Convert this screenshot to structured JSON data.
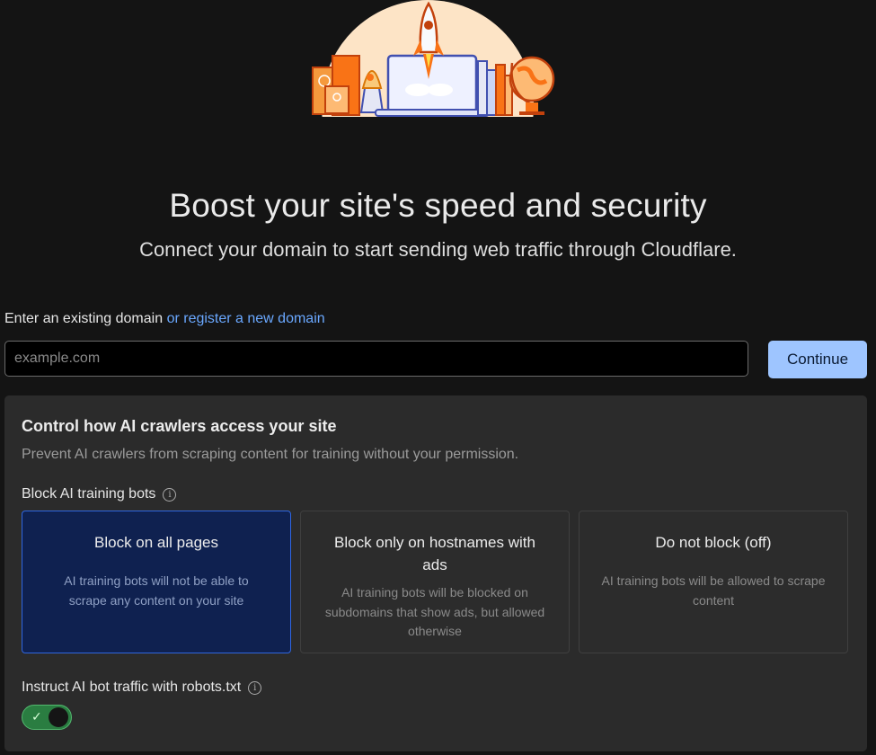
{
  "hero": {
    "icon": "rocket-launch-illustration"
  },
  "heading": "Boost your site's speed and security",
  "subtitle": "Connect your domain to start sending web traffic through Cloudflare.",
  "domain": {
    "label": "Enter an existing domain",
    "register_link": "or register a new domain",
    "placeholder": "example.com",
    "value": "",
    "continue_label": "Continue"
  },
  "ai_panel": {
    "title": "Control how AI crawlers access your site",
    "description": "Prevent AI crawlers from scraping content for training without your permission.",
    "block_label": "Block AI training bots",
    "options": [
      {
        "title": "Block on all pages",
        "description": "AI training bots will not be able to scrape any content on your site",
        "selected": true
      },
      {
        "title": "Block only on hostnames with ads",
        "description": "AI training bots will be blocked on subdomains that show ads, but allowed otherwise",
        "selected": false
      },
      {
        "title": "Do not block (off)",
        "description": "AI training bots will be allowed to scrape content",
        "selected": false
      }
    ],
    "robots_label": "Instruct AI bot traffic with robots.txt",
    "robots_enabled": true
  },
  "colors": {
    "accent_blue": "#9ec5ff",
    "link_blue": "#6aa8ff",
    "toggle_green": "#2a7d41",
    "selected_bg": "#0f2150",
    "selected_border": "#2f66e0"
  }
}
